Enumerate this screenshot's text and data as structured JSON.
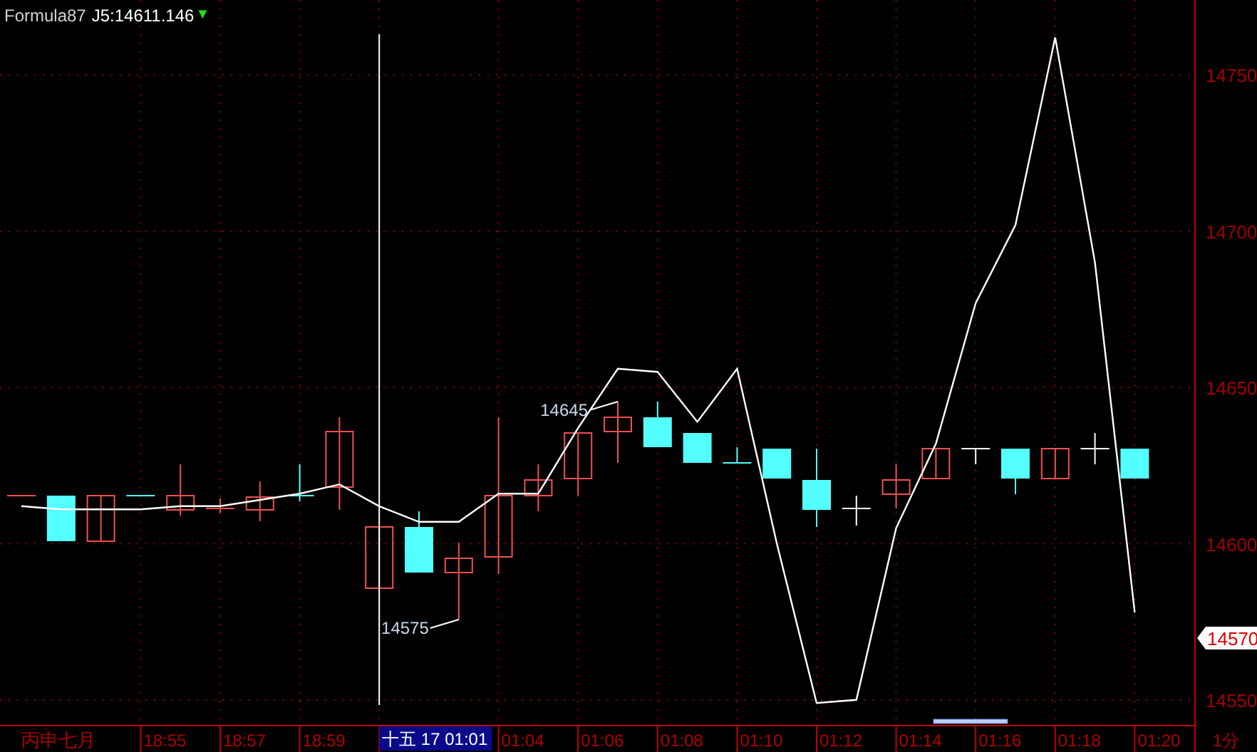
{
  "header": {
    "name": "Formula87",
    "value": "J5:14611.146",
    "arrow": "▼"
  },
  "chart": {
    "lunar_label": "丙申七月",
    "period": "1分",
    "price_tag": {
      "label": "14570"
    },
    "time_labels": [
      {
        "label": "18:55",
        "selected": false
      },
      {
        "label": "18:57",
        "selected": false
      },
      {
        "label": "18:59",
        "selected": false
      },
      {
        "label": "十五 17 01:01",
        "selected": true
      },
      {
        "label": "01:04",
        "selected": false
      },
      {
        "label": "01:06",
        "selected": false
      },
      {
        "label": "01:08",
        "selected": false
      },
      {
        "label": "01:10",
        "selected": false
      },
      {
        "label": "01:12",
        "selected": false
      },
      {
        "label": "01:14",
        "selected": false
      },
      {
        "label": "01:16",
        "selected": false
      },
      {
        "label": "01:18",
        "selected": false
      },
      {
        "label": "01:20",
        "selected": false
      }
    ],
    "chart_data": {
      "type": "line",
      "grid": true,
      "series": [
        {
          "color": "#ffffff",
          "values": [
            14612,
            14611,
            14611,
            14611,
            14612,
            14612,
            14614,
            14616,
            14619,
            14612,
            14607,
            14607,
            14616,
            14616,
            14637,
            14656,
            14655,
            14639,
            14656,
            14600,
            14549,
            14550,
            14605,
            14632,
            14677,
            14702,
            14762,
            14690,
            14578
          ]
        }
      ],
      "ylim": [
        14542,
        14774
      ],
      "yticks": [
        14550,
        14600,
        14650,
        14700,
        14750
      ],
      "annotations": [
        "14645",
        "14575"
      ]
    }
  }
}
